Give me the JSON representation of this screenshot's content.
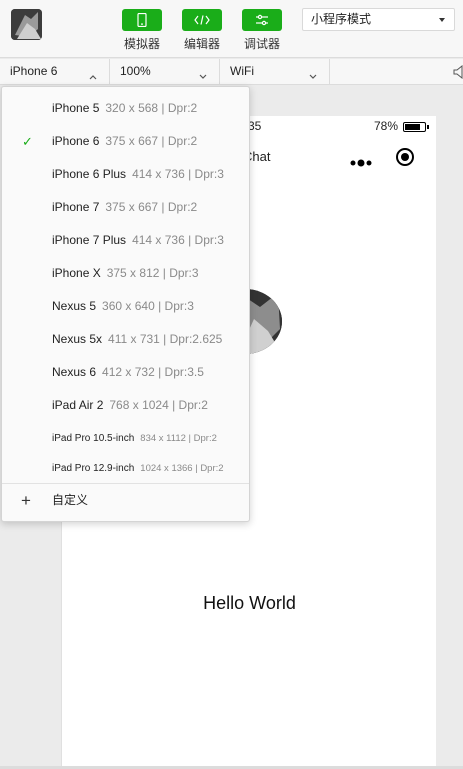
{
  "toolbar": {
    "buttons": [
      {
        "label": "模拟器",
        "icon": "phone-icon"
      },
      {
        "label": "编辑器",
        "icon": "code-icon"
      },
      {
        "label": "调试器",
        "icon": "debug-icon"
      }
    ],
    "mode_select": "小程序模式",
    "accent_color": "#1aad19"
  },
  "subbar": {
    "device": "iPhone 6",
    "zoom": "100%",
    "network": "WiFi"
  },
  "device_menu": {
    "selected": "iPhone 6",
    "items": [
      {
        "name": "iPhone 5",
        "spec": "320 x 568 | Dpr:2"
      },
      {
        "name": "iPhone 6",
        "spec": "375 x 667 | Dpr:2"
      },
      {
        "name": "iPhone 6 Plus",
        "spec": "414 x 736 | Dpr:3"
      },
      {
        "name": "iPhone 7",
        "spec": "375 x 667 | Dpr:2"
      },
      {
        "name": "iPhone 7 Plus",
        "spec": "414 x 736 | Dpr:3"
      },
      {
        "name": "iPhone X",
        "spec": "375 x 812 | Dpr:3"
      },
      {
        "name": "Nexus 5",
        "spec": "360 x 640 | Dpr:3"
      },
      {
        "name": "Nexus 5x",
        "spec": "411 x 731 | Dpr:2.625"
      },
      {
        "name": "Nexus 6",
        "spec": "412 x 732 | Dpr:3.5"
      },
      {
        "name": "iPad Air 2",
        "spec": "768 x 1024 | Dpr:2"
      },
      {
        "name": "iPad Pro 10.5-inch",
        "spec": "834 x 1112 | Dpr:2"
      },
      {
        "name": "iPad Pro 12.9-inch",
        "spec": "1024 x 1366 | Dpr:2"
      }
    ],
    "custom_label": "自定义"
  },
  "phone": {
    "status_time": "35",
    "battery_text": "78%",
    "battery_level": 0.78,
    "nav_title": "Chat",
    "hello_text": "Hello World"
  }
}
